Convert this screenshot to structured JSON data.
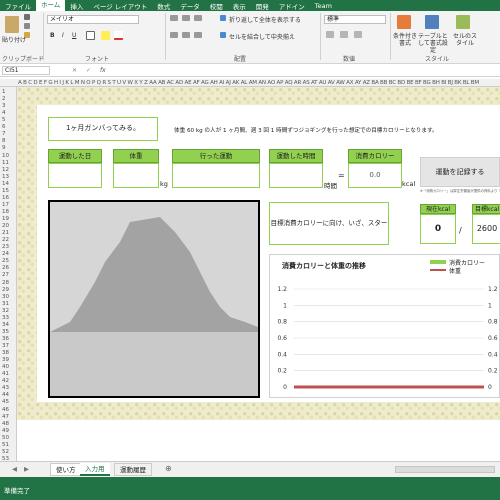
{
  "menu": {
    "file": "ファイル",
    "tabs": [
      "ホーム",
      "挿入",
      "ページ レイアウト",
      "数式",
      "データ",
      "校閲",
      "表示",
      "開発",
      "アドイン",
      "Team"
    ]
  },
  "ribbon": {
    "paste_label": "貼り付け",
    "clipboard_label": "クリップボード",
    "font_name": "メイリオ",
    "font_group_label": "フォント",
    "wrap_text": "折り返して全体を表示する",
    "merge_center": "セルを結合して中央揃え",
    "alignment_label": "配置",
    "number_format": "標準",
    "number_label": "数値",
    "conditional_format": "条件付き書式",
    "table_format": "テーブルとして書式設定",
    "cell_styles": "セルのスタイル",
    "styles_label": "スタイル"
  },
  "formula_bar": {
    "name_box": "CI51",
    "fx": "fx",
    "value": ""
  },
  "columns_header": "A B C D E F G H I J K L M N O P Q R S T U V W X Y Z AA AB AC AD AE AF AG AH AI AJ AK AL AM AN AO AP AQ AR AS AT AU AV AW AX AY AZ BA BB BC BD BE BF BG BH BI BJ BK BL BM",
  "rows": [
    "1",
    "2",
    "3",
    "4",
    "5",
    "6",
    "7",
    "8",
    "9",
    "10",
    "11",
    "12",
    "13",
    "14",
    "15",
    "16",
    "17",
    "18",
    "19",
    "20",
    "21",
    "22",
    "23",
    "24",
    "25",
    "26",
    "27",
    "28",
    "29",
    "30",
    "31",
    "32",
    "33",
    "34",
    "35",
    "36",
    "37",
    "38",
    "39",
    "40",
    "41",
    "42",
    "43",
    "44",
    "45",
    "46",
    "47",
    "48",
    "49",
    "50",
    "51",
    "52",
    "53"
  ],
  "sheet": {
    "title": "1ヶ月ガンバってみる。",
    "description": "体重 60 kg の人が 1 ヶ月間、週 3 回 1 時間ずつジョギングを行った想定での目標カロリーとなります。",
    "headers": {
      "date": "運動した日",
      "weight": "体重",
      "exercise": "行った運動",
      "time": "運動した時間",
      "calories": "消費カロリー"
    },
    "units": {
      "kg": "kg",
      "hours": "時間",
      "equals": "=",
      "kcal": "kcal"
    },
    "calorie_value": "0.0",
    "record_button": "運動を記録する",
    "note": "※『消費カロリー』は厚生労働省が提供の資料より『体重(kg)×時間×METs×1.05』で計算しています",
    "message": "目標消費カロリーに向け、いざ、スタート!!",
    "current_label": "現在kcal",
    "current_value": "0",
    "slash": "/",
    "target_label": "目標kcal",
    "target_value": "2600"
  },
  "chart_data": {
    "type": "bar",
    "title": "消費カロリーと体重の推移",
    "series": [
      {
        "name": "消費カロリー",
        "values": [
          0
        ]
      },
      {
        "name": "体重",
        "values": [
          0
        ]
      }
    ],
    "y_ticks": [
      "0",
      "0.2",
      "0.4",
      "0.6",
      "0.8",
      "1",
      "1.2"
    ],
    "y2_ticks": [
      "0",
      "0.2",
      "0.4",
      "0.6",
      "0.8",
      "1",
      "1.2"
    ],
    "ylim": [
      0,
      1.2
    ],
    "legend": "top-right",
    "colors": {
      "calories": "#92d050",
      "weight": "#c0504d"
    }
  },
  "sheet_tabs": [
    "使い方",
    "入力用",
    "運動履歴"
  ],
  "status": "準備完了"
}
